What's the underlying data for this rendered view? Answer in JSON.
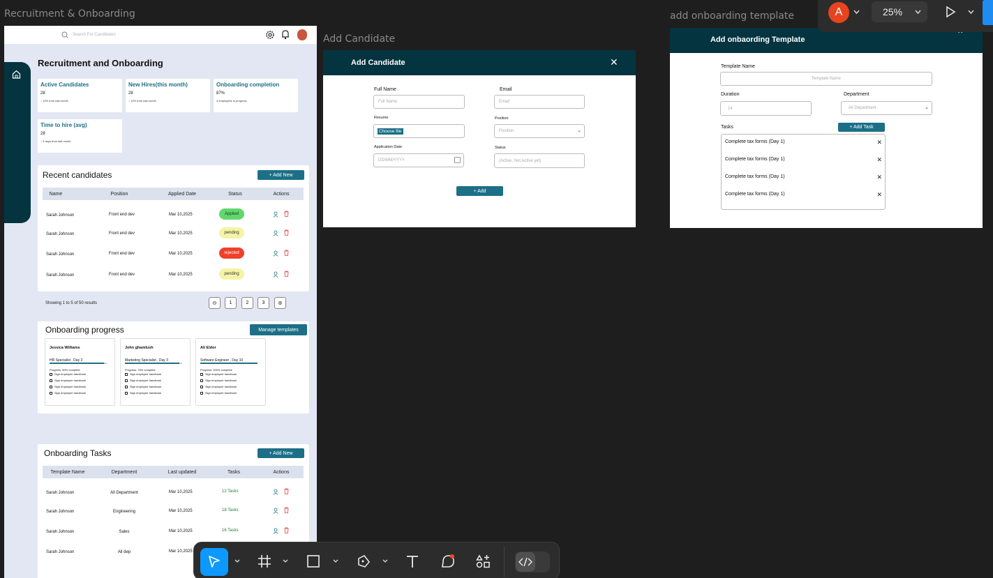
{
  "frame_labels": {
    "main": "Recruitment & Onboarding",
    "add_candidate": "Add Candidate",
    "template": "add onboarding template"
  },
  "header": {
    "search_placeholder": "Search For Candidates"
  },
  "page_title": "Recruitment and Onboarding",
  "stats": [
    {
      "title": "Active Candidates",
      "value": "28",
      "sub": "↑ 12% from last month"
    },
    {
      "title": "New Hires(this month)",
      "value": "28",
      "sub": "↑ 12% from last month"
    },
    {
      "title": "Onboarding completion",
      "value": "87%",
      "sub": "4 employees in progress"
    },
    {
      "title": "Time to hire (avg)",
      "value": "28",
      "sub": "↓ 3 days from last month"
    }
  ],
  "recent": {
    "title": "Recent candidates",
    "add_label": "+ Add New",
    "columns": [
      "Name",
      "Position",
      "Applied Date",
      "Status",
      "Actions"
    ],
    "rows": [
      {
        "name": "Sarah Johnson",
        "position": "Front end dev",
        "date": "Mar 10,2025",
        "status": "Applied"
      },
      {
        "name": "Sarah Johnson",
        "position": "Front end dev",
        "date": "Mar 10,2025",
        "status": "pending"
      },
      {
        "name": "Sarah Johnson",
        "position": "Front end dev",
        "date": "Mar 10,2025",
        "status": "rejected"
      },
      {
        "name": "Sarah Johnson",
        "position": "Front end dev",
        "date": "Mar 10,2025",
        "status": "pending"
      }
    ],
    "showing": "Showing 1 to 5 of 50 results",
    "pages": [
      "1",
      "2",
      "3"
    ]
  },
  "status_colors": {
    "Applied": "#5ed96b",
    "pending": "#f5f3a5",
    "rejected": "#f0402c"
  },
  "progress": {
    "title": "Onboarding progress",
    "manage_label": "Manage templates",
    "cards": [
      {
        "name": "Jessica Williams",
        "role": "HR Specialist . Day 3",
        "progress_text": "Progress: 50% complete",
        "progress": 0.95,
        "items": [
          "Sign employee handbook",
          "Sign employee handbook",
          "Sign employee handbook",
          "Sign employee handbook"
        ]
      },
      {
        "name": "John ghamlush",
        "role": "Marketing Specialist . Day 3",
        "progress_text": "Progress: 75% complete",
        "progress": 0.95,
        "items": [
          "Sign employee handbook",
          "Sign employee handbook",
          "Sign employee handbook",
          "Sign employee handbook"
        ]
      },
      {
        "name": "Ali Eldor",
        "role": "Software Engineer . Day 10",
        "progress_text": "Progress: 100% complete",
        "progress": 1.0,
        "items": [
          "Sign employee handbook",
          "Sign employee handbook",
          "Sign employee handbook",
          "Sign employee handbook"
        ]
      }
    ]
  },
  "tasks": {
    "title": "Onboarding Tasks",
    "add_label": "+ Add New",
    "columns": [
      "Template Name",
      "Department",
      "Last updated",
      "Tasks",
      "Actions"
    ],
    "rows": [
      {
        "name": "Sarah Johnson",
        "dept": "All Department",
        "date": "Mar 10,2025",
        "tasks": "12 Tasks"
      },
      {
        "name": "Sarah Johnson",
        "dept": "Engineering",
        "date": "Mar 10,2025",
        "tasks": "18 Tasks"
      },
      {
        "name": "Sarah Johnson",
        "dept": "Sales",
        "date": "Mar 10,2025",
        "tasks": "16 Tasks"
      },
      {
        "name": "Sarah Johnson",
        "dept": "All dep",
        "date": "Mar 10,2025",
        "tasks": ""
      }
    ]
  },
  "add_candidate": {
    "title": "Add Candidate",
    "full_name_label": "Full Name",
    "full_name_ph": "Full Name",
    "email_label": "Email",
    "email_ph": "Email",
    "resume_label": "Resume",
    "choose_file": "Choose file",
    "position_label": "Position",
    "position_ph": "Position",
    "date_label": "Application Date",
    "date_ph": "DD/MM/YYYY",
    "status_label": "Status",
    "status_ph": "(Active, Not Active yet)",
    "add_label": "+ Add"
  },
  "template": {
    "title": "Add onbaording Template",
    "name_label": "Template Name",
    "name_ph": "Template Name",
    "duration_label": "Duration",
    "duration_ph": "14",
    "dept_label": "Department",
    "dept_ph": "All Department",
    "tasks_label": "Tasks",
    "add_task": "+ Add Task",
    "tasks": [
      "Complete tax forms (Day 1)",
      "Complete tax forms (Day 1)",
      "Complete tax forms (Day 1)",
      "Complete tax forms (Day 1)"
    ]
  },
  "topright": {
    "avatar_letter": "A",
    "zoom": "25%"
  }
}
